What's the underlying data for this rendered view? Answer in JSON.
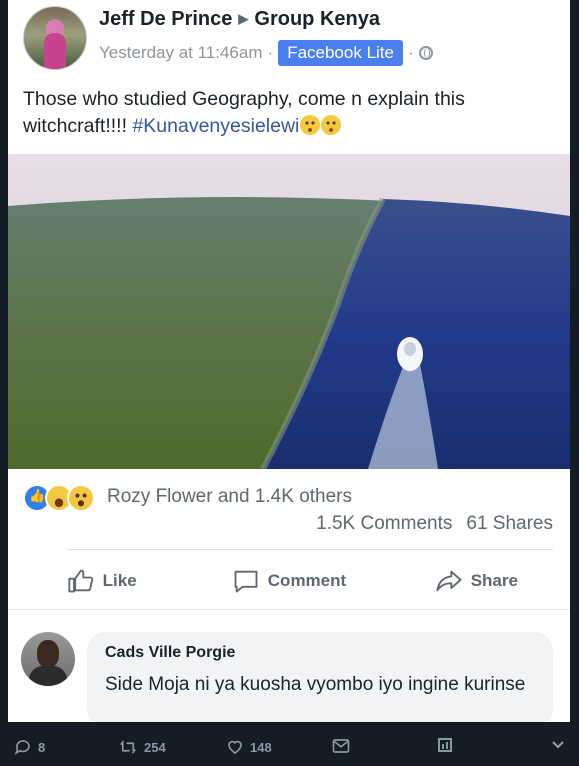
{
  "post": {
    "author": "Jeff De Prince",
    "group": "Group Kenya",
    "timestamp": "Yesterday at 11:46am",
    "separator": "·",
    "badge": "Facebook Lite",
    "text_main": "Those who studied Geography, come n explain this witchcraft!!!! ",
    "hashtag": "#Kunavenyesielewi",
    "icons": {
      "arrow": "triangle-right-icon",
      "globe": "globe-icon"
    }
  },
  "reactions": {
    "summary": "Rozy Flower and 1.4K others",
    "comments": "1.5K Comments",
    "shares": "61 Shares",
    "types": [
      "like",
      "haha",
      "wow"
    ]
  },
  "actions": {
    "like": "Like",
    "comment": "Comment",
    "share": "Share"
  },
  "comment": {
    "name": "Cads Ville Porgie",
    "text": "Side Moja ni ya kuosha vyombo iyo ingine kurinse"
  },
  "tweet_actions": {
    "replies": "8",
    "retweets": "254",
    "likes": "148"
  },
  "colors": {
    "link": "#365899",
    "badge": "#4a7ff0",
    "like_blue": "#2f80ed",
    "dark_bg": "#141d26"
  }
}
